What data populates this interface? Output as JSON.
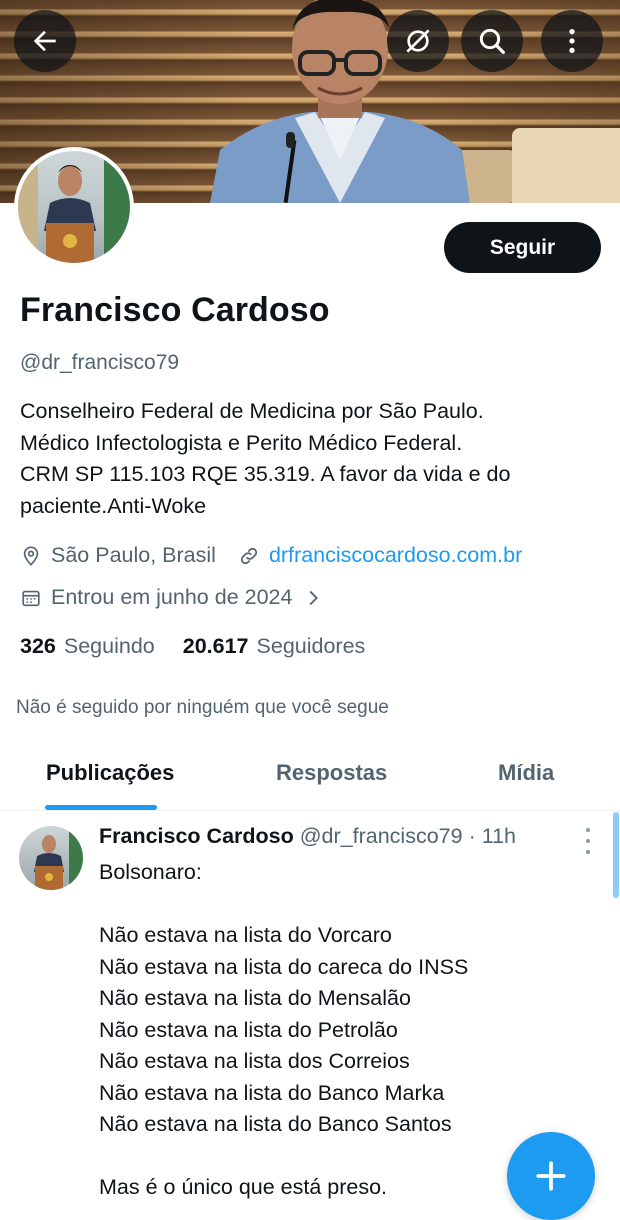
{
  "profile": {
    "name": "Francisco Cardoso",
    "handle": "@dr_francisco79",
    "bio_lines": [
      "Conselheiro Federal de Medicina por São Paulo.",
      "Médico Infectologista e Perito Médico Federal.",
      "CRM SP 115.103 RQE 35.319. A favor da vida e do",
      "paciente.Anti-Woke"
    ],
    "location": "São Paulo, Brasil",
    "website": "drfranciscocardoso.com.br",
    "joined": "Entrou em junho de 2024",
    "following_count": "326",
    "following_label": "Seguindo",
    "followers_count": "20.617",
    "followers_label": "Seguidores",
    "not_followed_text": "Não é seguido por ninguém que você segue",
    "follow_button": "Seguir"
  },
  "tabs": [
    "Publicações",
    "Respostas",
    "Mídia"
  ],
  "tweet": {
    "author_name": "Francisco Cardoso",
    "author_handle": "@dr_francisco79",
    "separator": "·",
    "time": "11h",
    "lines": [
      "Bolsonaro:",
      "",
      "Não estava na lista do Vorcaro",
      "Não estava na lista do careca do INSS",
      "Não estava na lista do Mensalão",
      "Não estava na lista do Petrolão",
      "Não estava na lista dos Correios",
      "Não estava na lista do Banco Marka",
      "Não estava na lista do Banco Santos",
      "",
      "Mas é o único que está preso."
    ]
  },
  "icons": {
    "back": "arrow-left-icon",
    "translate": "no-translate-icon",
    "search": "search-icon",
    "more": "more-vertical-icon",
    "location": "location-pin-icon",
    "link": "link-icon",
    "calendar": "calendar-icon",
    "chevron": "chevron-right-icon",
    "compose": "plus-icon"
  },
  "colors": {
    "accent": "#1d9bf0",
    "text": "#0f1419",
    "secondary": "#536471"
  }
}
